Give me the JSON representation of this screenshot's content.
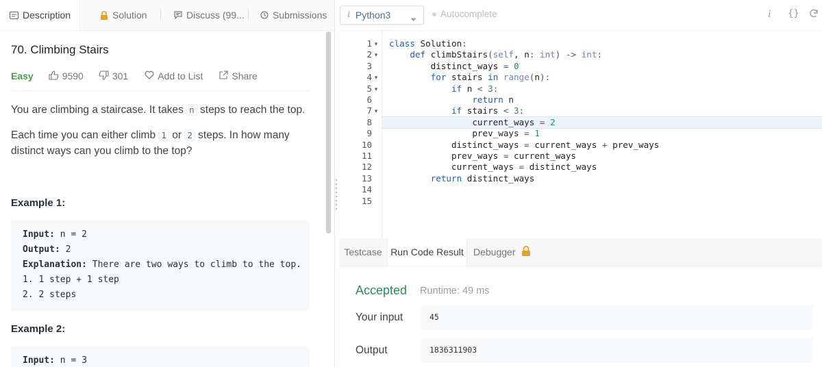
{
  "left_tabs": [
    {
      "label": "Description",
      "icon": "document-icon"
    },
    {
      "label": "Solution",
      "icon": "lock-icon"
    },
    {
      "label": "Discuss (99...",
      "icon": "comment-icon"
    },
    {
      "label": "Submissions",
      "icon": "clock-icon"
    }
  ],
  "problem": {
    "title": "70. Climbing Stairs",
    "difficulty": "Easy",
    "likes": "9590",
    "dislikes": "301",
    "add_to_list": "Add to List",
    "share": "Share",
    "para1_before": "You are climbing a staircase. It takes ",
    "para1_code": "n",
    "para1_after": " steps to reach the top.",
    "para2_a": "Each time you can either climb ",
    "para2_code1": "1",
    "para2_b": " or ",
    "para2_code2": "2",
    "para2_c": " steps. In how many distinct ways can you climb to the top?",
    "example1_title": "Example 1:",
    "example1": {
      "input_label": "Input:",
      "input_value": " n = 2",
      "output_label": "Output:",
      "output_value": " 2",
      "explanation_label": "Explanation:",
      "explanation_value": " There are two ways to climb to the top.",
      "line4": "1. 1 step + 1 step",
      "line5": "2. 2 steps"
    },
    "example2_title": "Example 2:",
    "example2": {
      "input_label": "Input:",
      "input_value": " n = 3"
    }
  },
  "editor": {
    "language_icon": "i",
    "language": "Python3",
    "autocomplete": "Autocomplete",
    "info_icon": "i",
    "braces_icon": "{}",
    "line_numbers": [
      "1",
      "2",
      "3",
      "4",
      "5",
      "6",
      "7",
      "8",
      "9",
      "10",
      "11",
      "12",
      "13",
      "14",
      "15"
    ],
    "fold_markers": [
      "▾",
      "▾",
      "",
      "▾",
      "▾",
      "",
      "▾",
      "",
      "",
      "",
      "",
      "",
      "",
      "",
      ""
    ],
    "highlighted_line": 8,
    "code_lines": [
      "class Solution:",
      "    def climbStairs(self, n: int) -> int:",
      "        distinct_ways = 0",
      "        for stairs in range(n):",
      "            if n < 3:",
      "                return n",
      "            if stairs < 3:",
      "                current_ways = 2",
      "                prev_ways = 1",
      "            distinct_ways = current_ways + prev_ways",
      "            prev_ways = current_ways",
      "            current_ways = distinct_ways",
      "        return distinct_ways",
      "",
      ""
    ]
  },
  "bottom_tabs": [
    {
      "label": "Testcase"
    },
    {
      "label": "Run Code Result"
    },
    {
      "label": "Debugger"
    }
  ],
  "result": {
    "status": "Accepted",
    "runtime": "Runtime: 49 ms",
    "input_label": "Your input",
    "input_value": "45",
    "output_label": "Output",
    "output_value": "1836311903"
  },
  "colors": {
    "accepted": "#2e8b57",
    "easy": "#43a047",
    "lock": "#e0a32e",
    "highlight": "#ebf3fd"
  }
}
